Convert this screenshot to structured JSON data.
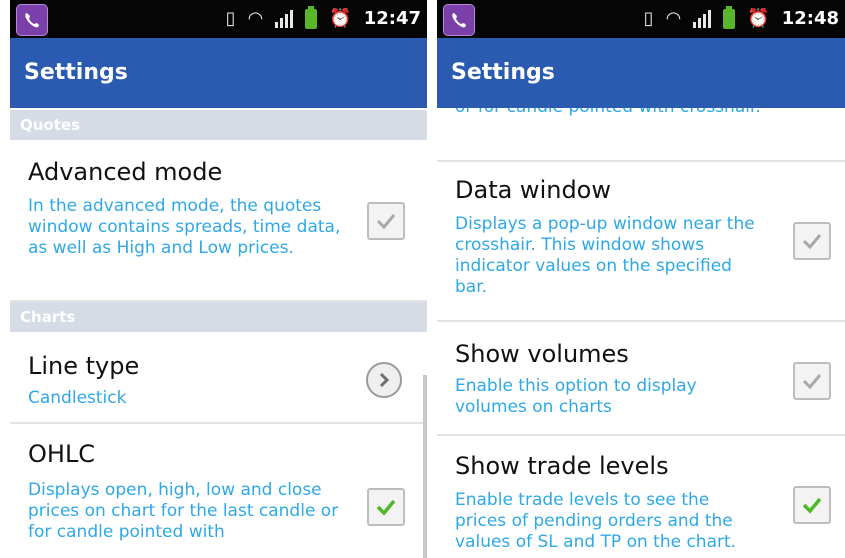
{
  "left_screen": {
    "status": {
      "time": "12:47",
      "icons": [
        "viber-app-icon",
        "vibrate-icon",
        "wifi-icon",
        "signal-icon",
        "battery-icon",
        "alarm-icon"
      ]
    },
    "title": "Settings",
    "quotes_header": "Quotes",
    "advanced_mode": {
      "title": "Advanced mode",
      "description": "In the advanced mode, the quotes window contains spreads, time data, as well as High and Low prices.",
      "checked": false
    },
    "charts_header": "Charts",
    "line_type": {
      "title": "Line type",
      "value": "Candlestick"
    },
    "ohlc": {
      "title": "OHLC",
      "description": "Displays open, high, low and close prices on chart for the last candle or for candle pointed with",
      "checked": true
    }
  },
  "right_screen": {
    "status": {
      "time": "12:48"
    },
    "title": "Settings",
    "partial_top": "or for candle pointed with crosshair.",
    "data_window": {
      "title": "Data window",
      "description": "Displays a pop-up window near the crosshair. This window shows indicator values on the specified bar.",
      "checked": false
    },
    "show_volumes": {
      "title": "Show volumes",
      "description": "Enable this option to display volumes on charts",
      "checked": false
    },
    "show_trade_levels": {
      "title": "Show trade levels",
      "description": "Enable trade levels to see the prices of pending orders and the values of SL and TP on the chart.",
      "checked": true
    }
  },
  "colors": {
    "title_bar": "#2b5bb0",
    "description_text": "#2ea8e6",
    "check_green": "#4fb82a",
    "check_gray": "#a9a9a9",
    "section_header": "#d6dce5"
  }
}
